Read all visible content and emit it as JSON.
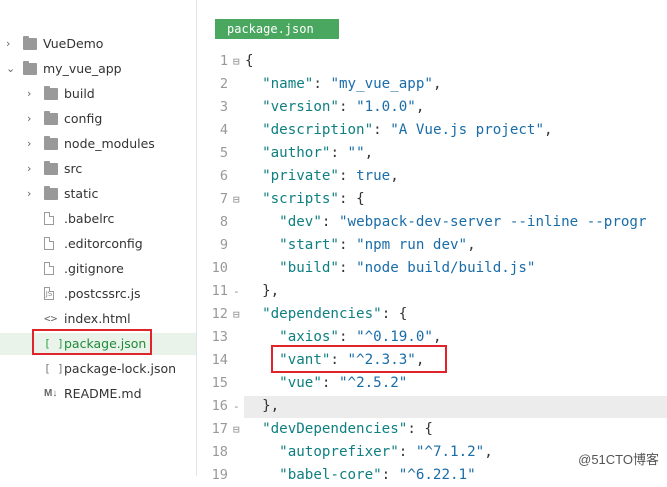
{
  "sidebar": {
    "items": [
      {
        "label": "VueDemo",
        "type": "folder",
        "expanded": false,
        "depth": 0
      },
      {
        "label": "my_vue_app",
        "type": "folder",
        "expanded": true,
        "depth": 0
      },
      {
        "label": "build",
        "type": "folder",
        "expanded": false,
        "depth": 1
      },
      {
        "label": "config",
        "type": "folder",
        "expanded": false,
        "depth": 1
      },
      {
        "label": "node_modules",
        "type": "folder",
        "expanded": false,
        "depth": 1
      },
      {
        "label": "src",
        "type": "folder",
        "expanded": false,
        "depth": 1
      },
      {
        "label": "static",
        "type": "folder",
        "expanded": false,
        "depth": 1
      },
      {
        "label": ".babelrc",
        "type": "file",
        "depth": 1
      },
      {
        "label": ".editorconfig",
        "type": "file",
        "depth": 1
      },
      {
        "label": ".gitignore",
        "type": "file",
        "depth": 1
      },
      {
        "label": ".postcssrc.js",
        "type": "js",
        "depth": 1
      },
      {
        "label": "index.html",
        "type": "html",
        "depth": 1
      },
      {
        "label": "package.json",
        "type": "json",
        "depth": 1,
        "selected": true
      },
      {
        "label": "package-lock.json",
        "type": "json",
        "depth": 1
      },
      {
        "label": "README.md",
        "type": "md",
        "depth": 1
      }
    ]
  },
  "editor": {
    "tab_label": "package.json",
    "lines": [
      {
        "n": "1",
        "fold": "⊟",
        "code": "{"
      },
      {
        "n": "2",
        "fold": "",
        "code": "  \"name\": \"my_vue_app\","
      },
      {
        "n": "3",
        "fold": "",
        "code": "  \"version\": \"1.0.0\","
      },
      {
        "n": "4",
        "fold": "",
        "code": "  \"description\": \"A Vue.js project\","
      },
      {
        "n": "5",
        "fold": "",
        "code": "  \"author\": \"\","
      },
      {
        "n": "6",
        "fold": "",
        "code": "  \"private\": true,"
      },
      {
        "n": "7",
        "fold": "⊟",
        "code": "  \"scripts\": {"
      },
      {
        "n": "8",
        "fold": "",
        "code": "    \"dev\": \"webpack-dev-server --inline --progr"
      },
      {
        "n": "9",
        "fold": "",
        "code": "    \"start\": \"npm run dev\","
      },
      {
        "n": "10",
        "fold": "",
        "code": "    \"build\": \"node build/build.js\""
      },
      {
        "n": "11",
        "fold": "-",
        "code": "  },"
      },
      {
        "n": "12",
        "fold": "⊟",
        "code": "  \"dependencies\": {"
      },
      {
        "n": "13",
        "fold": "",
        "code": "    \"axios\": \"^0.19.0\","
      },
      {
        "n": "14",
        "fold": "",
        "code": "    \"vant\": \"^2.3.3\","
      },
      {
        "n": "15",
        "fold": "",
        "code": "    \"vue\": \"^2.5.2\""
      },
      {
        "n": "16",
        "fold": "-",
        "code": "  },"
      },
      {
        "n": "17",
        "fold": "⊟",
        "code": "  \"devDependencies\": {"
      },
      {
        "n": "18",
        "fold": "",
        "code": "    \"autoprefixer\": \"^7.1.2\","
      },
      {
        "n": "19",
        "fold": "",
        "code": "    \"babel-core\": \"^6.22.1\""
      }
    ]
  },
  "watermark": "@51CTO博客",
  "colors": {
    "accent": "#4aa760",
    "key": "#0f7f81",
    "string": "#1a6da8",
    "highlight_box": "#e0242b"
  }
}
